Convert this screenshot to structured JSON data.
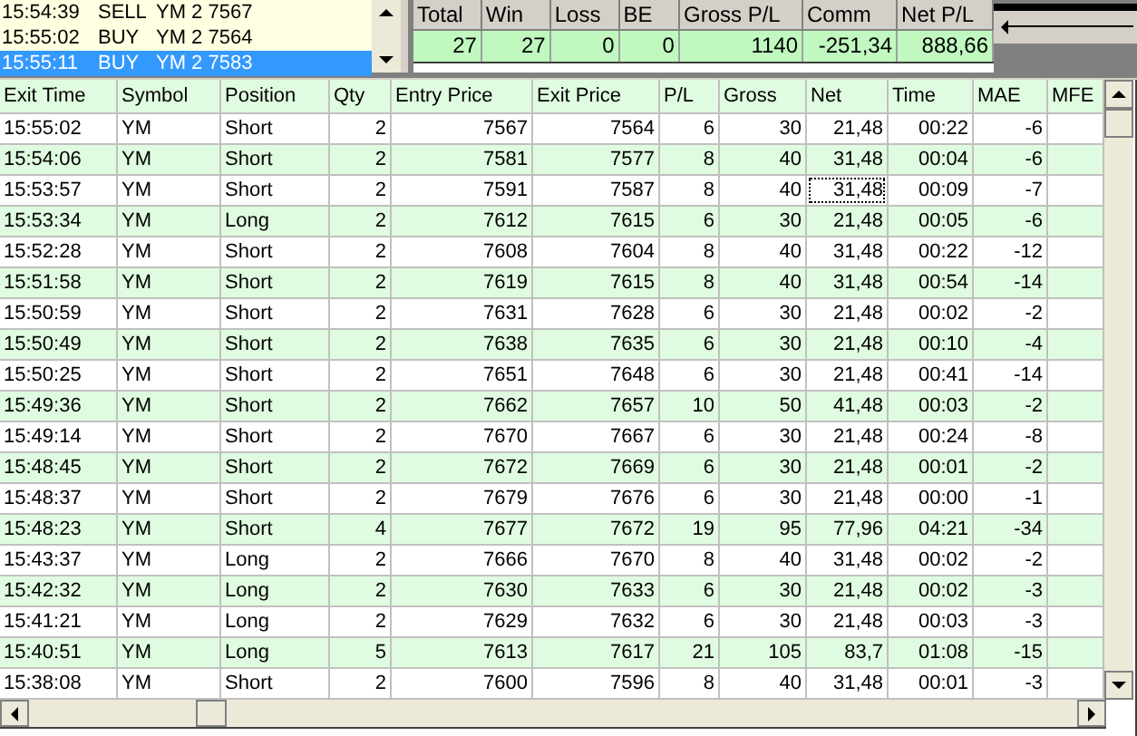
{
  "orders": [
    {
      "time": "15:54:39",
      "side": "SELL",
      "detail": "YM 2 7567",
      "selected": false
    },
    {
      "time": "15:55:02",
      "side": "BUY",
      "detail": "YM 2 7564",
      "selected": false
    },
    {
      "time": "15:55:11",
      "side": "BUY",
      "detail": "YM 2 7583",
      "selected": true
    }
  ],
  "summary": {
    "columns": [
      "Total",
      "Win",
      "Loss",
      "BE",
      "Gross P/L",
      "Comm",
      "Net P/L"
    ],
    "values": [
      "27",
      "27",
      "0",
      "0",
      "1140",
      "-251,34",
      "888,66"
    ]
  },
  "slider": {
    "level": 0
  },
  "table": {
    "columns": [
      "Exit Time",
      "Symbol",
      "Position",
      "Qty",
      "Entry Price",
      "Exit Price",
      "P/L",
      "Gross",
      "Net",
      "Time",
      "MAE",
      "MFE"
    ],
    "rows": [
      {
        "cells": [
          "15:55:02",
          "YM",
          "Short",
          "2",
          "7567",
          "7564",
          "6",
          "30",
          "21,48",
          "00:22",
          "-6"
        ],
        "net_focused": false
      },
      {
        "cells": [
          "15:54:06",
          "YM",
          "Short",
          "2",
          "7581",
          "7577",
          "8",
          "40",
          "31,48",
          "00:04",
          "-6"
        ],
        "net_focused": false
      },
      {
        "cells": [
          "15:53:57",
          "YM",
          "Short",
          "2",
          "7591",
          "7587",
          "8",
          "40",
          "31,48",
          "00:09",
          "-7"
        ],
        "net_focused": true
      },
      {
        "cells": [
          "15:53:34",
          "YM",
          "Long",
          "2",
          "7612",
          "7615",
          "6",
          "30",
          "21,48",
          "00:05",
          "-6"
        ],
        "net_focused": false
      },
      {
        "cells": [
          "15:52:28",
          "YM",
          "Short",
          "2",
          "7608",
          "7604",
          "8",
          "40",
          "31,48",
          "00:22",
          "-12"
        ],
        "net_focused": false
      },
      {
        "cells": [
          "15:51:58",
          "YM",
          "Short",
          "2",
          "7619",
          "7615",
          "8",
          "40",
          "31,48",
          "00:54",
          "-14"
        ],
        "net_focused": false
      },
      {
        "cells": [
          "15:50:59",
          "YM",
          "Short",
          "2",
          "7631",
          "7628",
          "6",
          "30",
          "21,48",
          "00:02",
          "-2"
        ],
        "net_focused": false
      },
      {
        "cells": [
          "15:50:49",
          "YM",
          "Short",
          "2",
          "7638",
          "7635",
          "6",
          "30",
          "21,48",
          "00:10",
          "-4"
        ],
        "net_focused": false
      },
      {
        "cells": [
          "15:50:25",
          "YM",
          "Short",
          "2",
          "7651",
          "7648",
          "6",
          "30",
          "21,48",
          "00:41",
          "-14"
        ],
        "net_focused": false
      },
      {
        "cells": [
          "15:49:36",
          "YM",
          "Short",
          "2",
          "7662",
          "7657",
          "10",
          "50",
          "41,48",
          "00:03",
          "-2"
        ],
        "net_focused": false
      },
      {
        "cells": [
          "15:49:14",
          "YM",
          "Short",
          "2",
          "7670",
          "7667",
          "6",
          "30",
          "21,48",
          "00:24",
          "-8"
        ],
        "net_focused": false
      },
      {
        "cells": [
          "15:48:45",
          "YM",
          "Short",
          "2",
          "7672",
          "7669",
          "6",
          "30",
          "21,48",
          "00:01",
          "-2"
        ],
        "net_focused": false
      },
      {
        "cells": [
          "15:48:37",
          "YM",
          "Short",
          "2",
          "7679",
          "7676",
          "6",
          "30",
          "21,48",
          "00:00",
          "-1"
        ],
        "net_focused": false
      },
      {
        "cells": [
          "15:48:23",
          "YM",
          "Short",
          "4",
          "7677",
          "7672",
          "19",
          "95",
          "77,96",
          "04:21",
          "-34"
        ],
        "net_focused": false
      },
      {
        "cells": [
          "15:43:37",
          "YM",
          "Long",
          "2",
          "7666",
          "7670",
          "8",
          "40",
          "31,48",
          "00:02",
          "-2"
        ],
        "net_focused": false
      },
      {
        "cells": [
          "15:42:32",
          "YM",
          "Long",
          "2",
          "7630",
          "7633",
          "6",
          "30",
          "21,48",
          "00:02",
          "-3"
        ],
        "net_focused": false
      },
      {
        "cells": [
          "15:41:21",
          "YM",
          "Long",
          "2",
          "7629",
          "7632",
          "6",
          "30",
          "21,48",
          "00:03",
          "-3"
        ],
        "net_focused": false
      },
      {
        "cells": [
          "15:40:51",
          "YM",
          "Long",
          "5",
          "7613",
          "7617",
          "21",
          "105",
          "83,7",
          "01:08",
          "-15"
        ],
        "net_focused": false
      },
      {
        "cells": [
          "15:38:08",
          "YM",
          "Short",
          "2",
          "7600",
          "7596",
          "8",
          "40",
          "31,48",
          "00:01",
          "-3"
        ],
        "net_focused": false
      }
    ]
  }
}
